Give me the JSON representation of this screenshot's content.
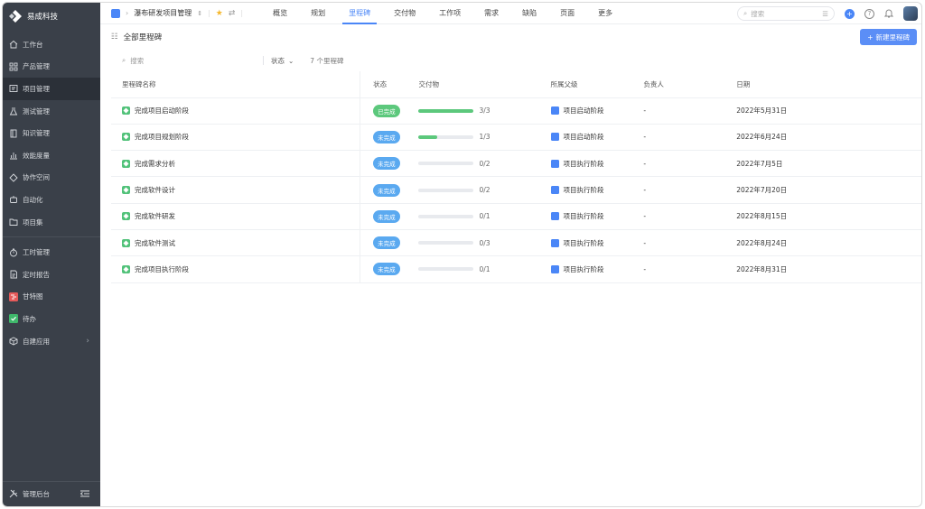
{
  "sidebar": {
    "brand": "易成科技",
    "items": [
      {
        "label": "工作台",
        "icon": "home-icon"
      },
      {
        "label": "产品管理",
        "icon": "grid-icon"
      },
      {
        "label": "项目管理",
        "icon": "project-icon",
        "active": true
      },
      {
        "label": "测试管理",
        "icon": "flask-icon"
      },
      {
        "label": "知识管理",
        "icon": "book-icon"
      },
      {
        "label": "效能度量",
        "icon": "chart-icon"
      },
      {
        "label": "协作空间",
        "icon": "diamond-icon"
      },
      {
        "label": "自动化",
        "icon": "robot-icon"
      },
      {
        "label": "项目集",
        "icon": "folder-icon"
      }
    ],
    "items2": [
      {
        "label": "工时管理",
        "icon": "timer-icon"
      },
      {
        "label": "定时报告",
        "icon": "report-icon"
      },
      {
        "label": "甘特图",
        "icon": "gantt-icon",
        "color": "#e55a5a"
      },
      {
        "label": "待办",
        "icon": "todo-icon",
        "color": "#3fb86b"
      },
      {
        "label": "自建应用",
        "icon": "cube-icon"
      }
    ],
    "footer": "管理后台"
  },
  "topbar": {
    "project": "瀑布研发项目管理",
    "tabs": [
      "概览",
      "规划",
      "里程碑",
      "交付物",
      "工作项",
      "需求",
      "缺陷",
      "页面",
      "更多"
    ],
    "active_tab": "里程碑",
    "search_placeholder": "搜索",
    "accent": "#4a86f7"
  },
  "content": {
    "title": "全部里程碑",
    "new_button": "新建里程碑",
    "filter": {
      "search_placeholder": "搜索",
      "status_label": "状态",
      "count_text": "7 个里程碑"
    },
    "columns": [
      "里程碑名称",
      "状态",
      "交付物",
      "所属父级",
      "负责人",
      "日期"
    ],
    "rows": [
      {
        "name": "完成项目启动阶段",
        "status": "已完成",
        "status_color": "#5cc87c",
        "progress": 1.0,
        "deliverables": "3/3",
        "parent": "项目启动阶段",
        "owner": "-",
        "date": "2022年5月31日"
      },
      {
        "name": "完成项目规划阶段",
        "status": "未完成",
        "status_color": "#5aa9f0",
        "progress": 0.333,
        "deliverables": "1/3",
        "parent": "项目启动阶段",
        "owner": "-",
        "date": "2022年6月24日"
      },
      {
        "name": "完成需求分析",
        "status": "未完成",
        "status_color": "#5aa9f0",
        "progress": 0,
        "deliverables": "0/2",
        "parent": "项目执行阶段",
        "owner": "-",
        "date": "2022年7月5日"
      },
      {
        "name": "完成软件设计",
        "status": "未完成",
        "status_color": "#5aa9f0",
        "progress": 0,
        "deliverables": "0/2",
        "parent": "项目执行阶段",
        "owner": "-",
        "date": "2022年7月20日"
      },
      {
        "name": "完成软件研发",
        "status": "未完成",
        "status_color": "#5aa9f0",
        "progress": 0,
        "deliverables": "0/1",
        "parent": "项目执行阶段",
        "owner": "-",
        "date": "2022年8月15日"
      },
      {
        "name": "完成软件测试",
        "status": "未完成",
        "status_color": "#5aa9f0",
        "progress": 0,
        "deliverables": "0/3",
        "parent": "项目执行阶段",
        "owner": "-",
        "date": "2022年8月24日"
      },
      {
        "name": "完成项目执行阶段",
        "status": "未完成",
        "status_color": "#5aa9f0",
        "progress": 0,
        "deliverables": "0/1",
        "parent": "项目执行阶段",
        "owner": "-",
        "date": "2022年8月31日"
      }
    ]
  }
}
